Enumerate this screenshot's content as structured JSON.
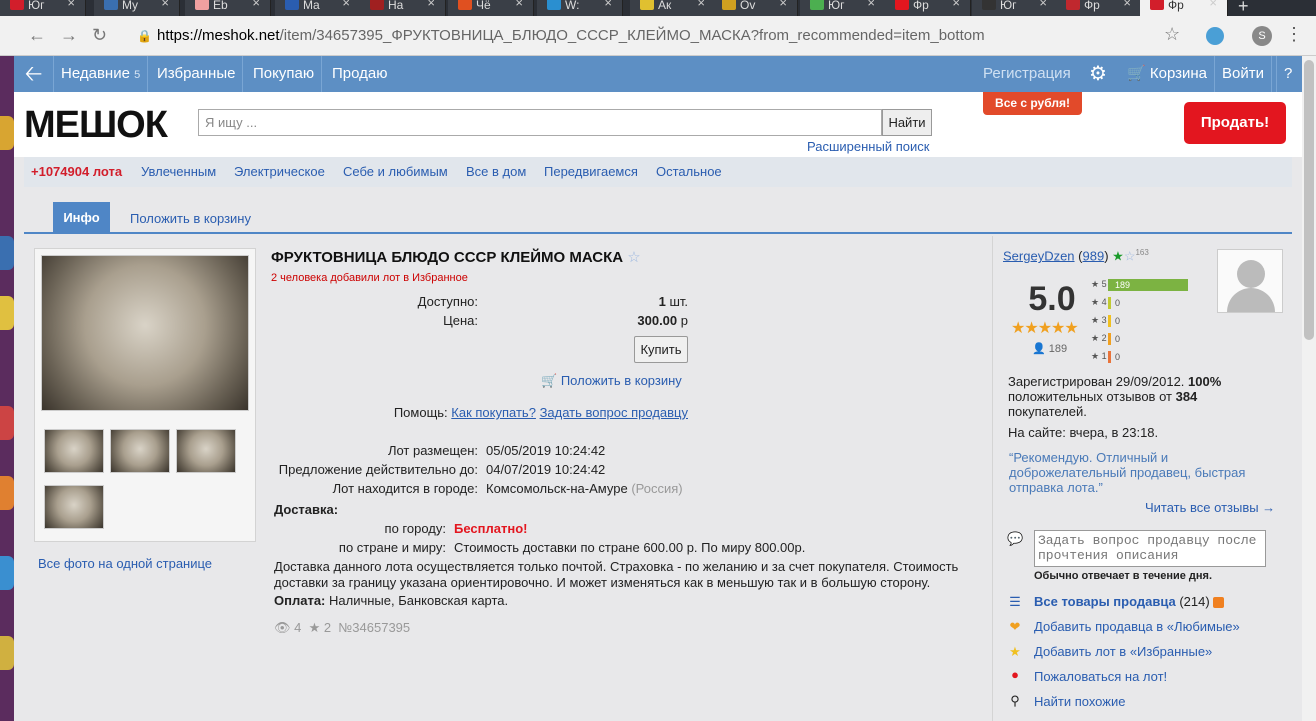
{
  "browser": {
    "tabs": [
      {
        "label": "Юг"
      },
      {
        "label": "My"
      },
      {
        "label": "Eb"
      },
      {
        "label": "Ma"
      },
      {
        "label": "На"
      },
      {
        "label": "Чё"
      },
      {
        "label": "W:"
      },
      {
        "label": "Ак"
      },
      {
        "label": "Ov"
      },
      {
        "label": "Юг"
      },
      {
        "label": "Фр"
      },
      {
        "label": "Юг"
      },
      {
        "label": "Фр"
      },
      {
        "label": "Фр"
      }
    ],
    "new_tab": "+",
    "url_host": "https://meshok.net",
    "url_rest": "/item/34657395_ФРУКТОВНИЦА_БЛЮДО_СССР_КЛЕЙМО_МАСКА?from_recommended=item_bottom",
    "profile_initial": "S"
  },
  "nav": {
    "recent": "Недавние",
    "recent_count": "5",
    "favorites": "Избранные",
    "buying": "Покупаю",
    "selling": "Продаю",
    "register": "Регистрация",
    "cart": "Корзина",
    "login": "Войти",
    "help": "?"
  },
  "header": {
    "logo": "МЕШОК",
    "search_placeholder": "Я ищу ...",
    "find": "Найти",
    "advanced": "Расширенный поиск",
    "promo": "Все с рубля!",
    "sell": "Продать!"
  },
  "categories": {
    "lots": "+1074904 лота",
    "items": [
      "Увлеченным",
      "Электрическое",
      "Себе и любимым",
      "Все в дом",
      "Передвигаемся",
      "Остальное"
    ]
  },
  "page_tabs": {
    "info": "Инфо",
    "to_cart": "Положить в корзину"
  },
  "item": {
    "title": "ФРУКТОВНИЦА БЛЮДО СССР КЛЕЙМО МАСКА",
    "favorites_note": "2 человека добавили лот в Избранное",
    "available_label": "Доступно:",
    "available_value": "1",
    "available_unit": "шт.",
    "price_label": "Цена:",
    "price_value": "300.00",
    "price_unit": "р",
    "buy": "Купить",
    "to_cart": "Положить в корзину",
    "help_label": "Помощь:",
    "how_to_buy": "Как покупать?",
    "ask_seller": "Задать вопрос продавцу",
    "placed_label": "Лот размещен:",
    "placed_value": "05/05/2019 10:24:42",
    "valid_label": "Предложение действительно до:",
    "valid_value": "04/07/2019 10:24:42",
    "city_label": "Лот находится в городе:",
    "city_value": "Комсомольск-на-Амуре",
    "country": "(Россия)",
    "delivery_label": "Доставка:",
    "city_delivery_label": "по городу:",
    "city_delivery_value": "Бесплатно!",
    "world_delivery_label": "по стране и миру:",
    "world_delivery_value": "Стоимость доставки по стране 600.00 р. По миру 800.00р.",
    "delivery_note": "Доставка данного лота осуществляется только почтой. Страховка - по желанию и за счет покупателя. Стоимость доставки за границу указана ориентировочно. И может изменяться как в меньшую так и в большую сторону.",
    "payment_label": "Оплата:",
    "payment_value": "Наличные, Банковская карта.",
    "views": "4",
    "stars": "2",
    "lot_no": "№34657395",
    "all_photos": "Все фото на одной странице"
  },
  "seller": {
    "name": "SergeyDzen",
    "count": "989",
    "badge_count": "163",
    "rating": "5.0",
    "reviews": "189",
    "bars": [
      {
        "label": "5",
        "value": 189
      },
      {
        "label": "4",
        "value": 0
      },
      {
        "label": "3",
        "value": 0
      },
      {
        "label": "2",
        "value": 0
      },
      {
        "label": "1",
        "value": 0
      }
    ],
    "registered_text": "Зарегистрирован 29/09/2012.",
    "positive_pct": "100%",
    "positive_text": "положительных отзывов от",
    "buyers": "384",
    "buyers_text": "покупателей.",
    "online": "На сайте: вчера, в 23:18.",
    "quote": "“Рекомендую. Отличный и доброжелательный продавец, быстрая отправка лота.”",
    "read_all": "Читать все отзывы →",
    "question_placeholder": "Задать вопрос продавцу после прочтения описания",
    "replies": "Обычно отвечает в течение дня.",
    "all_goods": "Все товары продавца",
    "all_goods_count": "(214)",
    "add_fav_seller": "Добавить продавца в «Любимые»",
    "add_fav_lot": "Добавить лот в «Избранные»",
    "complain": "Пожаловаться на лот!",
    "find_similar": "Найти похожие"
  }
}
